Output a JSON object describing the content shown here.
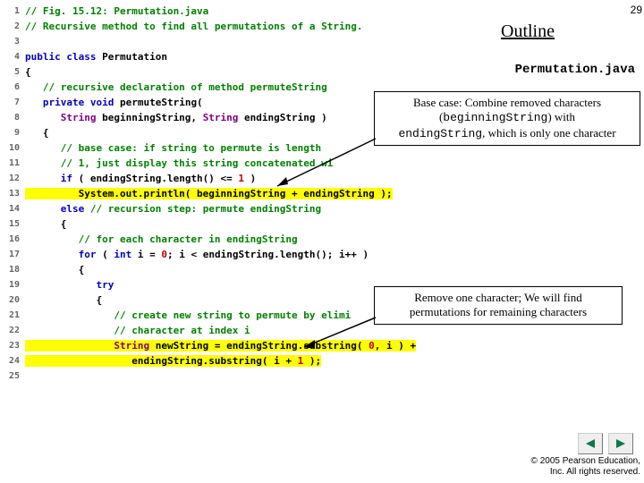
{
  "page_number": "29",
  "outline_label": "Outline",
  "filename": "Permutation.java",
  "callouts": {
    "base_case_l1": "Base case: Combine removed characters",
    "base_case_l2a": "(",
    "base_case_l2b": "beginningString",
    "base_case_l2c": ") with",
    "base_case_l3a": "endingString",
    "base_case_l3b": ", which is only one character",
    "remove_l1": "Remove one character; We will find",
    "remove_l2": "permutations for remaining characters"
  },
  "code": {
    "l1a": "// Fig. 15.12: Permutation.java",
    "l2a": "// Recursive method to find all permutations of a String.",
    "l4_kw": "public class ",
    "l4_name": "Permutation",
    "l6a": "   // recursive declaration of method permuteString",
    "l7_kw1": "   private void ",
    "l7_name": "permuteString(",
    "l8_t1": "      String ",
    "l8_v1": "beginningString, ",
    "l8_t2": "String ",
    "l8_v2": "endingString )",
    "l10a": "      // base case: if string to permute is length",
    "l11a": "      // 1, just display this string concatenated wi",
    "l12_kw": "      if ",
    "l12_a": "( endingString.length() <= ",
    "l12_n": "1",
    "l12_b": " )",
    "l13_a": "         System.out.println( beginningString + endingString );",
    "l14_kw": "      else ",
    "l14_c": "// recursion step: permute endingString",
    "l16a": "         // for each character in endingString",
    "l17_kw": "         for ",
    "l17_a": "( ",
    "l17_int": "int ",
    "l17_b": "i = ",
    "l17_n1": "0",
    "l17_c": "; i < endingString.length(); i++ )",
    "l19_kw": "            try",
    "l21a": "               // create new string to permute by elimi",
    "l22a": "               // character at index i",
    "l23_t": "               String ",
    "l23_a": "newString = endingString.substring( ",
    "l23_n": "0",
    "l23_b": ", i ) +",
    "l24_a": "                  endingString.substring( i + ",
    "l24_n": "1",
    "l24_b": " );"
  },
  "footer": {
    "copyright": "© 2005 Pearson Education,",
    "rights": "Inc.  All rights reserved."
  }
}
